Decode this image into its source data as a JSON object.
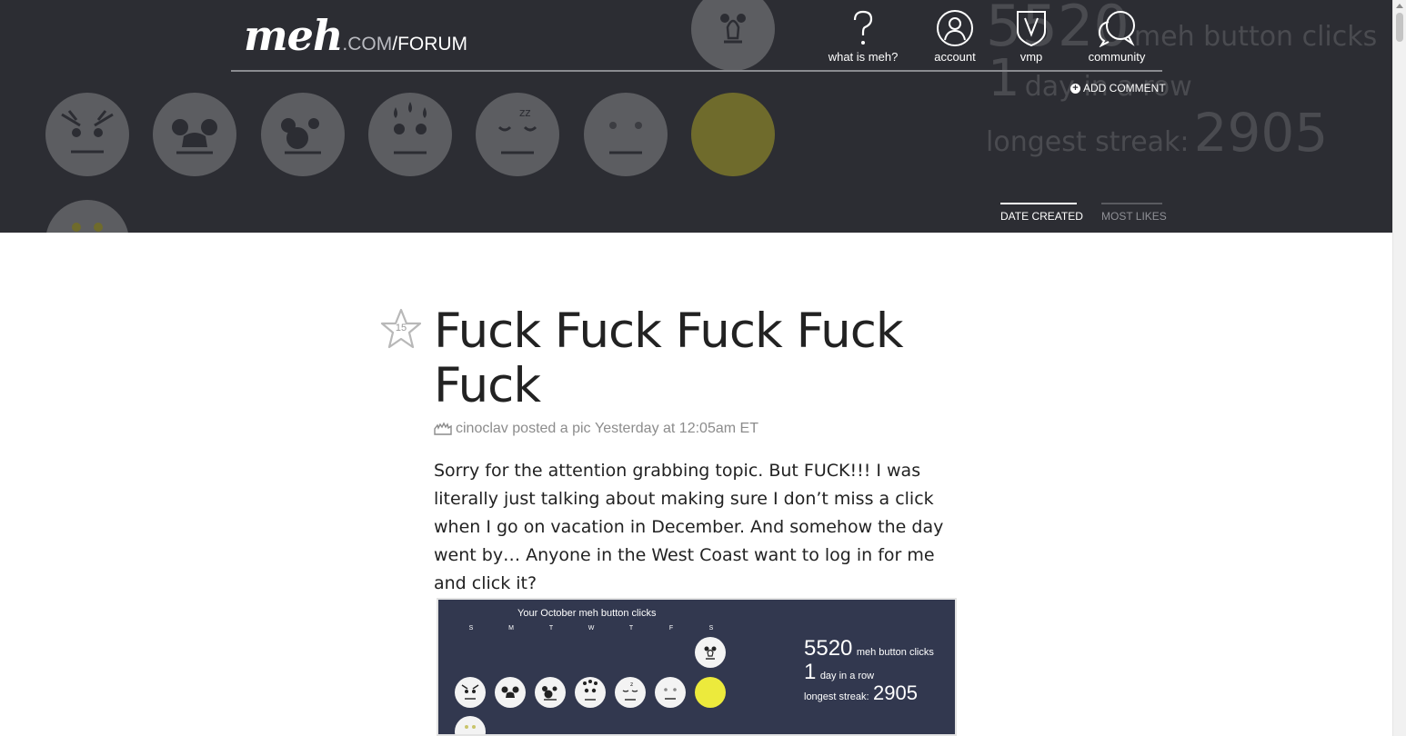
{
  "site": {
    "logo_main": "meh",
    "logo_dot": ".",
    "logo_com": "COM",
    "logo_forum": "/FORUM"
  },
  "nav": [
    {
      "label": "what is meh?",
      "icon": "question-icon"
    },
    {
      "label": "account",
      "icon": "user-icon"
    },
    {
      "label": "vmp",
      "icon": "vmp-shield-icon"
    },
    {
      "label": "community",
      "icon": "speech-bubbles-icon"
    }
  ],
  "header_stats": {
    "clicks_num": "5520",
    "clicks_label": "meh button clicks",
    "row_num": "1",
    "row_label": "day in a row",
    "streak_label": "longest streak:",
    "streak_num": "2905"
  },
  "add_comment": "ADD COMMENT",
  "tabs": [
    {
      "label": "DATE CREATED",
      "active": true
    },
    {
      "label": "MOST LIKES",
      "active": false
    }
  ],
  "post": {
    "star_count": "15",
    "title": "Fuck Fuck Fuck Fuck Fuck",
    "author": "cinoclav",
    "action": "posted a pic",
    "time": "Yesterday at 12:05am ET",
    "body": "Sorry for the attention grabbing topic. But FUCK!!! I was literally just talking about making sure I don’t miss a click when I go on vacation in December. And somehow the day went by… Anyone in the West Coast want to log in for me and click it?"
  },
  "pic": {
    "title": "Your October meh button clicks",
    "days": [
      "S",
      "M",
      "T",
      "W",
      "T",
      "F",
      "S"
    ],
    "clicks_num": "5520",
    "clicks_label": "meh button clicks",
    "row_num": "1",
    "row_label": "day in a row",
    "streak_label": "longest streak:",
    "streak_num": "2905"
  },
  "colors": {
    "header_bg": "#2c2d33",
    "pic_bg": "#32384f",
    "yellow": "#ecea3c"
  }
}
